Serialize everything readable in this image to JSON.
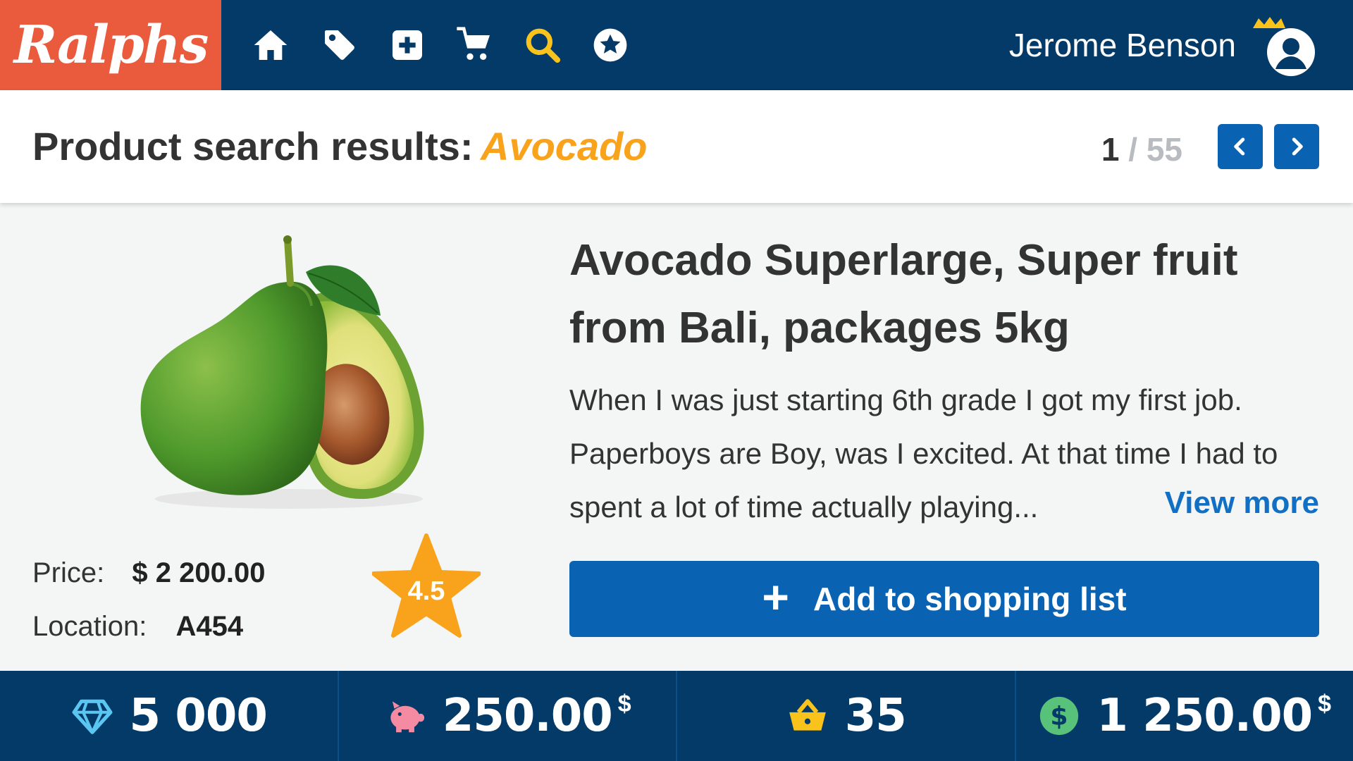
{
  "brand": {
    "name": "Ralphs",
    "logo_color": "#ea5a3c",
    "nav_color": "#043a67",
    "accent": "#0a62b2",
    "highlight": "#f9a21b"
  },
  "nav": {
    "icons": [
      "home-icon",
      "tag-icon",
      "add-box-icon",
      "cart-icon",
      "search-icon",
      "star-badge-icon"
    ],
    "active": "search-icon",
    "user_name": "Jerome Benson"
  },
  "search": {
    "label": "Product search results:",
    "query": "Avocado",
    "page_current": "1",
    "page_separator": "/",
    "page_total": "55"
  },
  "product": {
    "title": "Avocado Superlarge, Super fruit from Bali, packages 5kg",
    "description": "When I was just starting 6th grade I got my first job. Paperboys are Boy, was I excited. At that time I had to spent a lot of time actually playing...",
    "view_more": "View more",
    "price_label": "Price:",
    "price_value": "$ 2 200.00",
    "location_label": "Location:",
    "location_value": "A454",
    "rating": "4.5",
    "add_button": "Add to shopping list"
  },
  "stats": {
    "gems": "5 000",
    "savings": "250.00",
    "savings_currency": "$",
    "basket": "35",
    "balance": "1 250.00",
    "balance_currency": "$"
  }
}
